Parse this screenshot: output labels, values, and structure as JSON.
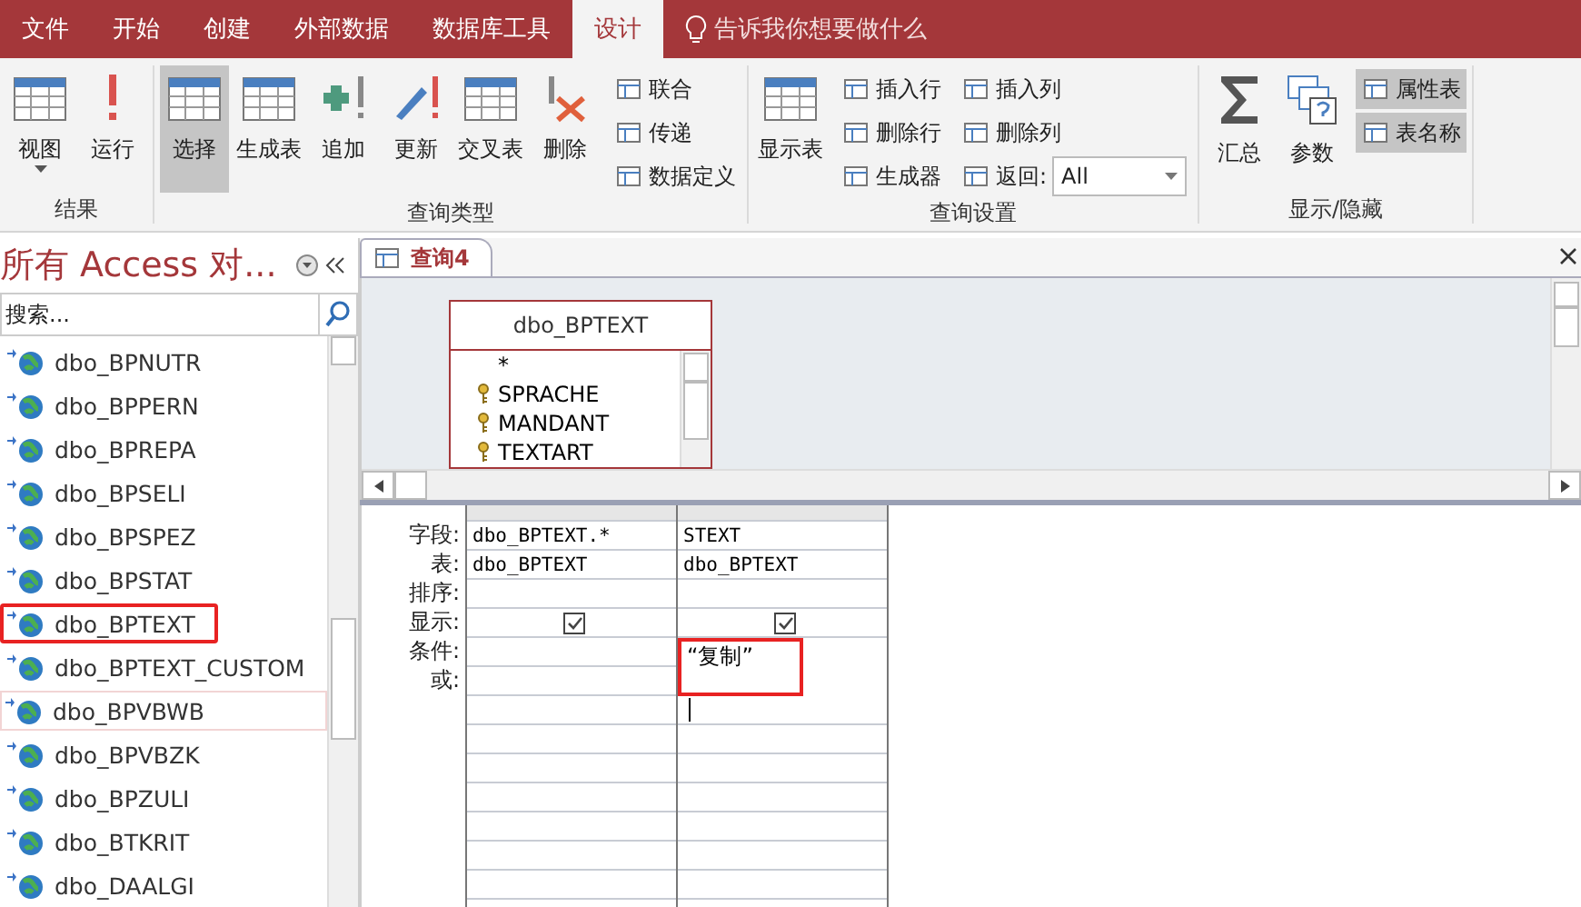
{
  "menu_tabs": [
    {
      "label": "文件",
      "selected": false
    },
    {
      "label": "开始",
      "selected": false
    },
    {
      "label": "创建",
      "selected": false
    },
    {
      "label": "外部数据",
      "selected": false
    },
    {
      "label": "数据库工具",
      "selected": false
    },
    {
      "label": "设计",
      "selected": true
    }
  ],
  "tell_me": {
    "placeholder": "告诉我你想要做什么"
  },
  "ribbon": [
    {
      "title": "结果",
      "large": [
        {
          "label": "视图",
          "dropdown": true,
          "selected": false
        },
        {
          "label": "运行",
          "dropdown": false,
          "selected": false
        }
      ]
    },
    {
      "title": "查询类型",
      "large": [
        {
          "label": "选择",
          "dropdown": false,
          "selected": true
        },
        {
          "label": "生成表",
          "dropdown": false,
          "selected": false
        },
        {
          "label": "追加",
          "dropdown": false,
          "selected": false
        },
        {
          "label": "更新",
          "dropdown": false,
          "selected": false
        },
        {
          "label": "交叉表",
          "dropdown": false,
          "selected": false
        },
        {
          "label": "删除",
          "dropdown": false,
          "selected": false
        }
      ],
      "small": [
        [
          {
            "label": "联合",
            "selected": false
          },
          {
            "label": "传递",
            "selected": false
          },
          {
            "label": "数据定义",
            "selected": false
          }
        ]
      ]
    },
    {
      "title": "查询设置",
      "large": [
        {
          "label": "显示表",
          "dropdown": false,
          "selected": false
        }
      ],
      "small": [
        [
          {
            "label": "插入行",
            "selected": false
          },
          {
            "label": "删除行",
            "selected": false
          },
          {
            "label": "生成器",
            "selected": false
          }
        ],
        [
          {
            "label": "插入列",
            "selected": false
          },
          {
            "label": "删除列",
            "selected": false
          },
          {
            "label": "返回:",
            "selected": false,
            "value": "All"
          }
        ]
      ]
    },
    {
      "title": "显示/隐藏",
      "large": [
        {
          "label": "汇总",
          "dropdown": false,
          "selected": false
        },
        {
          "label": "参数",
          "dropdown": false,
          "selected": false
        }
      ],
      "small": [
        [
          {
            "label": "属性表",
            "selected": true
          },
          {
            "label": "表名称",
            "selected": true
          }
        ]
      ]
    }
  ],
  "nav": {
    "title": "所有 Access 对...",
    "search": {
      "placeholder": "搜索..."
    },
    "items": [
      {
        "label": "dbo_BPNUTR",
        "highlighted": false,
        "hovered": false
      },
      {
        "label": "dbo_BPPERN",
        "highlighted": false,
        "hovered": false
      },
      {
        "label": "dbo_BPREPA",
        "highlighted": false,
        "hovered": false
      },
      {
        "label": "dbo_BPSELI",
        "highlighted": false,
        "hovered": false
      },
      {
        "label": "dbo_BPSPEZ",
        "highlighted": false,
        "hovered": false
      },
      {
        "label": "dbo_BPSTAT",
        "highlighted": false,
        "hovered": false
      },
      {
        "label": "dbo_BPTEXT",
        "highlighted": true,
        "hovered": false
      },
      {
        "label": "dbo_BPTEXT_CUSTOM",
        "highlighted": false,
        "hovered": false
      },
      {
        "label": "dbo_BPVBWB",
        "highlighted": false,
        "hovered": true
      },
      {
        "label": "dbo_BPVBZK",
        "highlighted": false,
        "hovered": false
      },
      {
        "label": "dbo_BPZULI",
        "highlighted": false,
        "hovered": false
      },
      {
        "label": "dbo_BTKRIT",
        "highlighted": false,
        "hovered": false
      },
      {
        "label": "dbo_DAALGI",
        "highlighted": false,
        "hovered": false
      }
    ]
  },
  "document_tab": {
    "label": "查询4",
    "selected": true
  },
  "table_box": {
    "title": "dbo_BPTEXT",
    "fields": [
      {
        "name": "*",
        "key": false
      },
      {
        "name": "SPRACHE",
        "key": true
      },
      {
        "name": "MANDANT",
        "key": true
      },
      {
        "name": "TEXTART",
        "key": true
      }
    ]
  },
  "grid": {
    "row_labels": [
      "字段:",
      "表:",
      "排序:",
      "显示:",
      "条件:",
      "或:"
    ],
    "columns": [
      {
        "field": "dbo_BPTEXT.*",
        "table": "dbo_BPTEXT",
        "show": true,
        "criteria_highlighted": false,
        "cursor": false
      },
      {
        "field": "STEXT",
        "table": "dbo_BPTEXT",
        "show": true,
        "criteria": "“复制”",
        "criteria_highlighted": true,
        "cursor": true
      }
    ]
  }
}
